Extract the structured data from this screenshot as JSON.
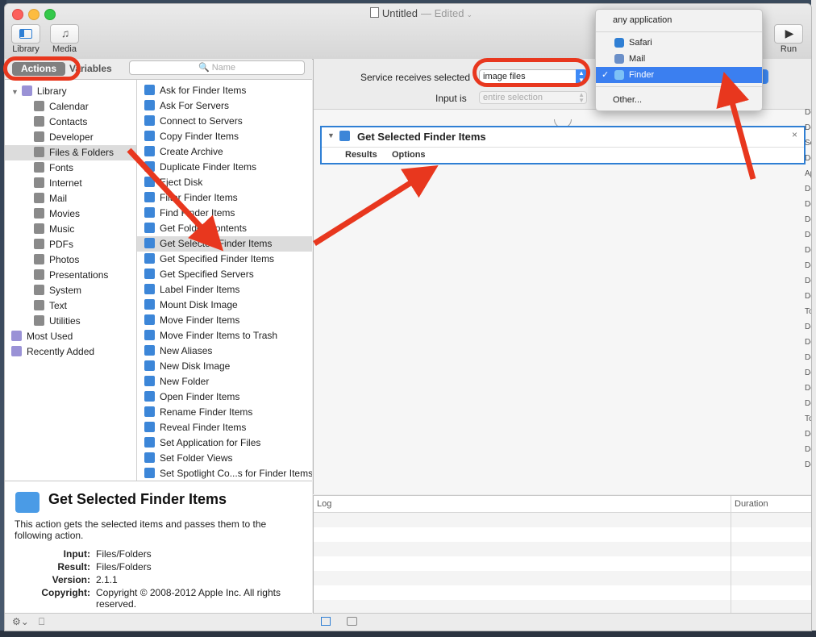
{
  "window": {
    "title": "Untitled",
    "edited": "— Edited",
    "chevron": "⌄"
  },
  "toolbar": {
    "library_label": "Library",
    "media_label": "Media",
    "run_label": "Run",
    "media_glyph": "♫",
    "run_glyph": "▶"
  },
  "tabs": {
    "actions": "Actions",
    "variables": "Variables",
    "search_placeholder": "🔍 Name"
  },
  "categories": [
    {
      "label": "Library",
      "indent": 0,
      "disclosure": "▼"
    },
    {
      "label": "Calendar",
      "indent": 1
    },
    {
      "label": "Contacts",
      "indent": 1
    },
    {
      "label": "Developer",
      "indent": 1
    },
    {
      "label": "Files & Folders",
      "indent": 1,
      "selected": true
    },
    {
      "label": "Fonts",
      "indent": 1
    },
    {
      "label": "Internet",
      "indent": 1
    },
    {
      "label": "Mail",
      "indent": 1
    },
    {
      "label": "Movies",
      "indent": 1
    },
    {
      "label": "Music",
      "indent": 1
    },
    {
      "label": "PDFs",
      "indent": 1
    },
    {
      "label": "Photos",
      "indent": 1
    },
    {
      "label": "Presentations",
      "indent": 1
    },
    {
      "label": "System",
      "indent": 1
    },
    {
      "label": "Text",
      "indent": 1
    },
    {
      "label": "Utilities",
      "indent": 1
    },
    {
      "label": "Most Used",
      "indent": 0
    },
    {
      "label": "Recently Added",
      "indent": 0
    }
  ],
  "actions": [
    {
      "label": "Ask for Finder Items"
    },
    {
      "label": "Ask For Servers"
    },
    {
      "label": "Connect to Servers"
    },
    {
      "label": "Copy Finder Items"
    },
    {
      "label": "Create Archive"
    },
    {
      "label": "Duplicate Finder Items"
    },
    {
      "label": "Eject Disk"
    },
    {
      "label": "Filter Finder Items"
    },
    {
      "label": "Find Finder Items"
    },
    {
      "label": "Get Folder Contents"
    },
    {
      "label": "Get Selected Finder Items",
      "selected": true
    },
    {
      "label": "Get Specified Finder Items"
    },
    {
      "label": "Get Specified Servers"
    },
    {
      "label": "Label Finder Items"
    },
    {
      "label": "Mount Disk Image"
    },
    {
      "label": "Move Finder Items"
    },
    {
      "label": "Move Finder Items to Trash"
    },
    {
      "label": "New Aliases"
    },
    {
      "label": "New Disk Image"
    },
    {
      "label": "New Folder"
    },
    {
      "label": "Open Finder Items"
    },
    {
      "label": "Rename Finder Items"
    },
    {
      "label": "Reveal Finder Items"
    },
    {
      "label": "Set Application for Files"
    },
    {
      "label": "Set Folder Views"
    },
    {
      "label": "Set Spotlight Co...s for Finder Items"
    }
  ],
  "description": {
    "title": "Get Selected Finder Items",
    "text": "This action gets the selected items and passes them to the following action.",
    "input_label": "Input:",
    "input": "Files/Folders",
    "result_label": "Result:",
    "result": "Files/Folders",
    "version_label": "Version:",
    "version": "2.1.1",
    "copyright_label": "Copyright:",
    "copyright": "Copyright © 2008-2012 Apple Inc.  All rights reserved."
  },
  "service": {
    "receives_label": "Service receives selected",
    "receives_value": "image files",
    "input_is_label": "Input is",
    "input_is_value": "entire selection"
  },
  "workflow_action": {
    "title": "Get Selected Finder Items",
    "results_tab": "Results",
    "options_tab": "Options",
    "close": "×"
  },
  "log": {
    "log_header": "Log",
    "duration_header": "Duration"
  },
  "popup": {
    "any_application": "any application",
    "safari": "Safari",
    "mail": "Mail",
    "finder": "Finder",
    "other": "Other...",
    "checkmark": "✓"
  },
  "right_strip_text": "Do\nDe\nSe\nDe\nAp\nDe\nDe\nDe\nDe\nDe\nDe\nDe\nDe\nTo\nDe\nDe\nDe\nDe\nDe\nDe\nTo\nDe\nDe\nDe",
  "bottom": {
    "gear_glyph": "⚙⌄",
    "box_glyph": "⎕"
  },
  "colors": {
    "accent": "#3b7ff0",
    "annotation_red": "#e8371e"
  }
}
